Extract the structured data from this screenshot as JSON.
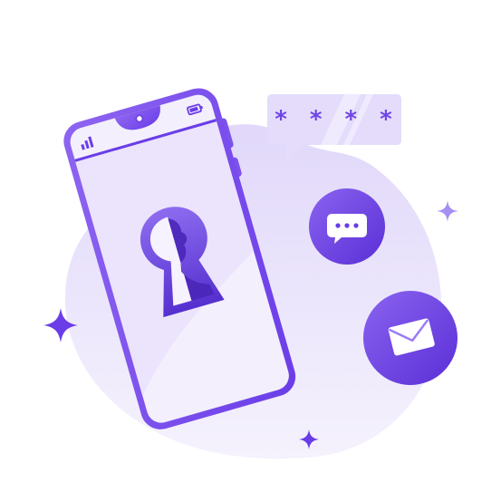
{
  "password_bubble": {
    "masked_text": "* * * *",
    "icon": "password-bubble-icon"
  },
  "chat_badge": {
    "icon": "chat-icon"
  },
  "mail_badge": {
    "icon": "mail-icon"
  },
  "phone": {
    "lock_icon": "keyhole-icon"
  },
  "colors": {
    "primary": "#6a3de8",
    "primary_light": "#8f6df2",
    "blob": "#ece6fb",
    "screen": "#f1edfc"
  }
}
